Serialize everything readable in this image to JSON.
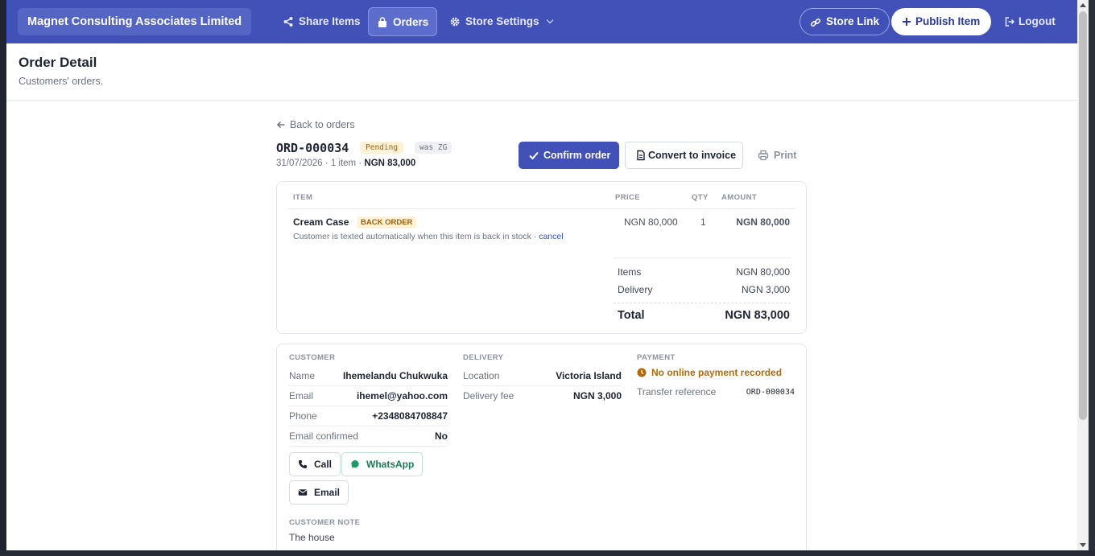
{
  "header": {
    "brand": "Magnet Consulting Associates Limited",
    "nav": [
      {
        "label": "Share Items",
        "icon": "share-icon"
      },
      {
        "label": "Orders",
        "icon": "bag-icon"
      },
      {
        "label": "Store Settings",
        "icon": "gear-icon"
      }
    ],
    "store_link": "Store Link",
    "publish": "Publish Item",
    "logout": "Logout",
    "colors": {
      "bar": "#4151b8",
      "accent": "#4151b8"
    }
  },
  "page": {
    "title": "Order Detail",
    "subtitle": "Customers' orders."
  },
  "order": {
    "back": "Back to orders",
    "id": "ORD-000034",
    "status": "Pending",
    "source": "was ZG",
    "date": "31/07/2026",
    "count": "1 item",
    "total_short": "NGN 83,000",
    "sep": "·",
    "actions": {
      "confirm": "Confirm order",
      "invoice": "Convert to invoice",
      "print": "Print"
    }
  },
  "items_table": {
    "headers": {
      "item": "ITEM",
      "price": "PRICE",
      "qty": "QTY",
      "amount": "AMOUNT"
    },
    "rows": [
      {
        "name": "Cream Case",
        "badge": "BACK ORDER",
        "note": "Customer is texted automatically when this item is back in stock ·",
        "note_link": "cancel",
        "price": "NGN 80,000",
        "qty": "1",
        "amount": "NGN 80,000"
      }
    ],
    "summary": {
      "items_label": "Items",
      "items_value": "NGN 80,000",
      "delivery_label": "Delivery",
      "delivery_value": "NGN 3,000",
      "total_label": "Total",
      "total_value": "NGN 83,000"
    }
  },
  "customer": {
    "title": "CUSTOMER",
    "fields": [
      {
        "k": "Name",
        "v": "Ihemelandu Chukwuka"
      },
      {
        "k": "Email",
        "v": "ihemel@yahoo.com"
      },
      {
        "k": "Phone",
        "v": "+2348084708847"
      },
      {
        "k": "Email confirmed",
        "v": "No"
      }
    ],
    "buttons": {
      "call": "Call",
      "whatsapp": "WhatsApp",
      "email": "Email"
    },
    "note_title": "CUSTOMER NOTE",
    "note": "The house"
  },
  "delivery": {
    "title": "DELIVERY",
    "fields": [
      {
        "k": "Location",
        "v": "Victoria Island"
      },
      {
        "k": "Delivery fee",
        "v": "NGN 3,000"
      }
    ]
  },
  "payment": {
    "title": "PAYMENT",
    "warning": "No online payment recorded",
    "fields": [
      {
        "k": "Transfer reference",
        "v": "ORD-000034"
      }
    ]
  }
}
